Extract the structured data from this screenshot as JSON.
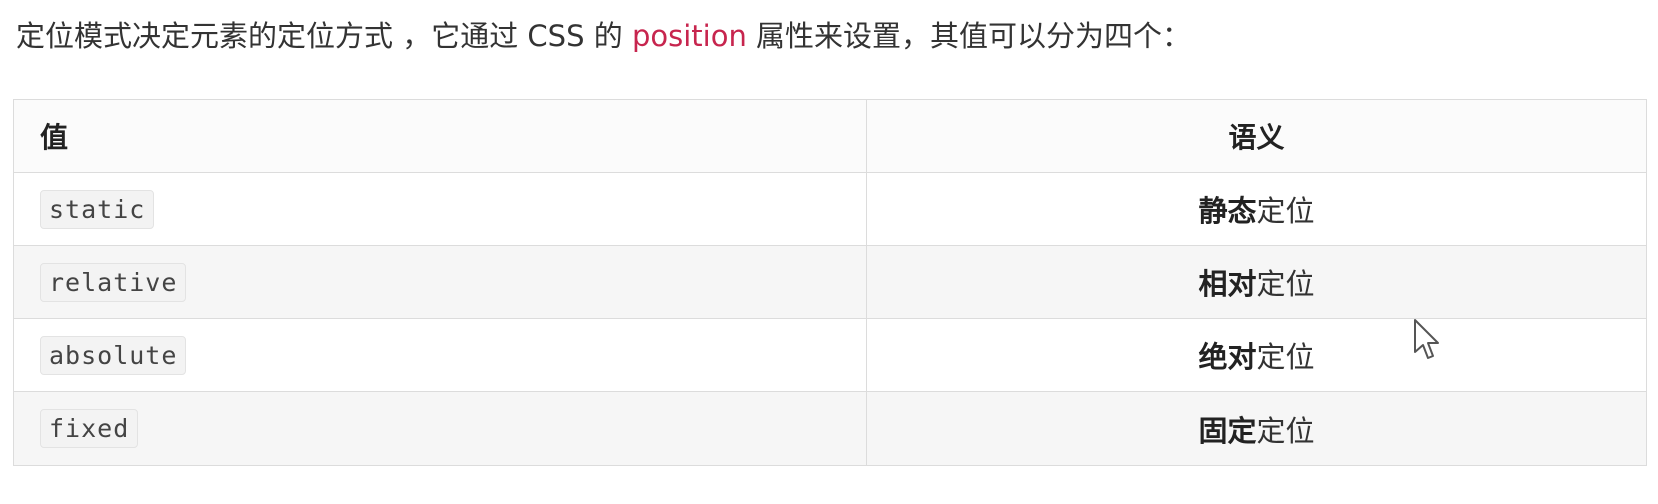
{
  "intro": {
    "before": "定位模式决定元素的定位方式 ，它通过 CSS 的 ",
    "keyword": "position",
    "after": " 属性来设置，其值可以分为四个："
  },
  "table": {
    "headers": {
      "value": "值",
      "meaning": "语义"
    },
    "rows": [
      {
        "value": "static",
        "meaning_bold": "静态",
        "meaning_rest": "定位"
      },
      {
        "value": "relative",
        "meaning_bold": "相对",
        "meaning_rest": "定位"
      },
      {
        "value": "absolute",
        "meaning_bold": "绝对",
        "meaning_rest": "定位"
      },
      {
        "value": "fixed",
        "meaning_bold": "固定",
        "meaning_rest": "定位"
      }
    ]
  },
  "cursor": {
    "icon": "mouse-pointer-icon"
  },
  "colors": {
    "keyword": "#c7254e",
    "border": "#dcdcdc",
    "code_bg": "#f3f3f3"
  }
}
